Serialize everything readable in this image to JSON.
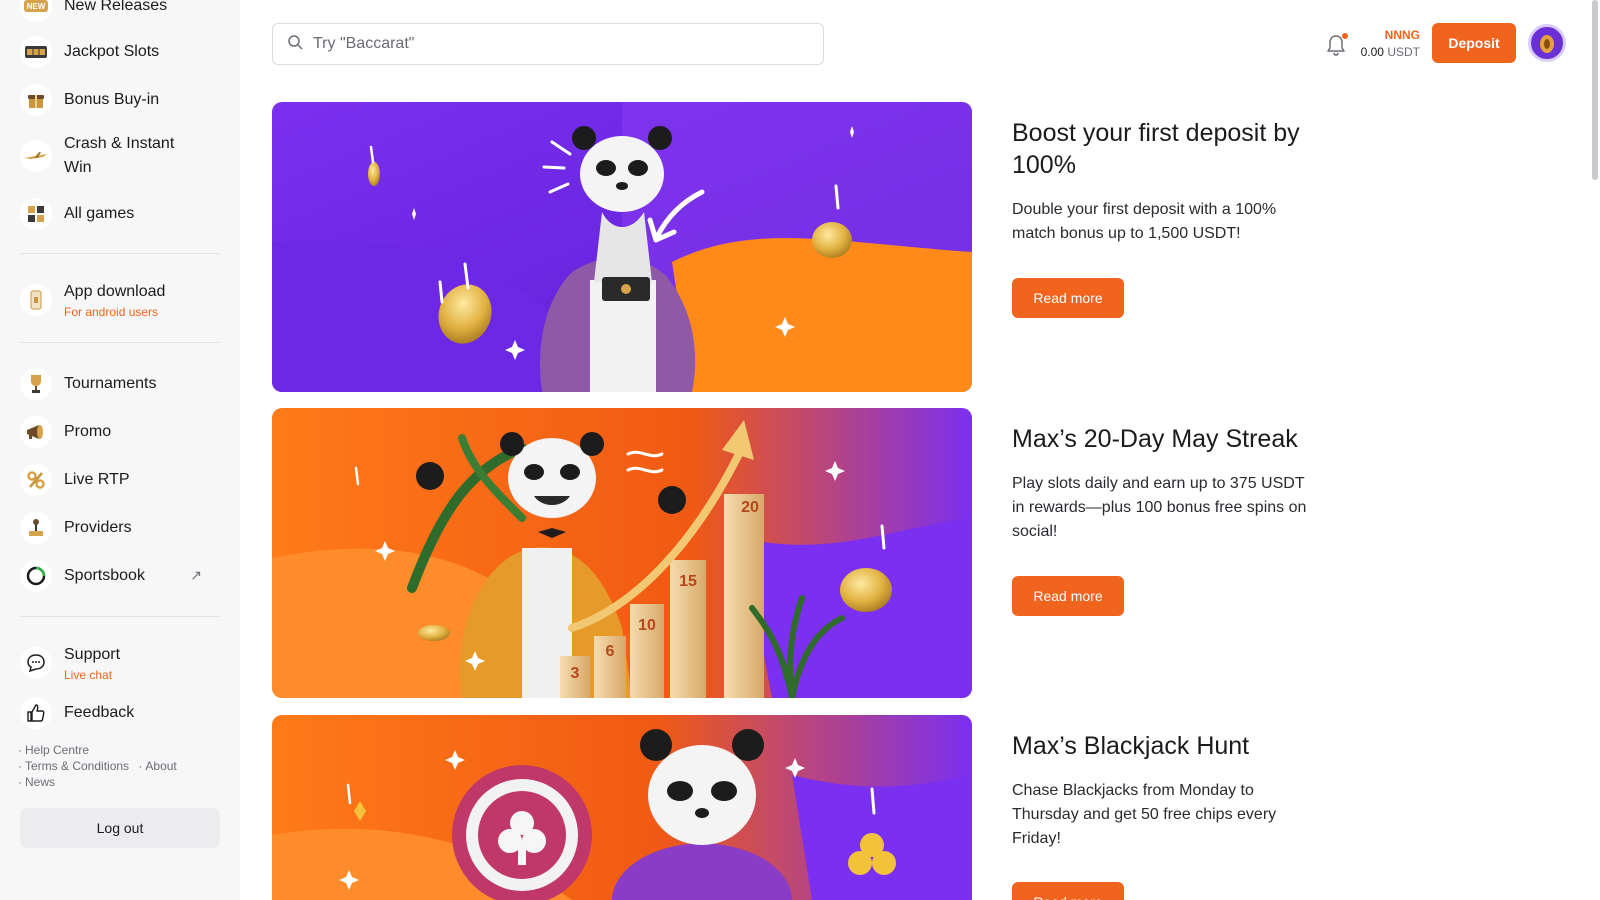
{
  "sidebar": {
    "items": [
      {
        "label": "New Releases",
        "icon": "new-badge-icon"
      },
      {
        "label": "Jackpot Slots",
        "icon": "slot-machine-icon"
      },
      {
        "label": "Bonus Buy-in",
        "icon": "gift-box-icon"
      },
      {
        "label": "Crash & Instant Win",
        "icon": "airplane-icon"
      },
      {
        "label": "All games",
        "icon": "grid-icon"
      },
      {
        "label": "App download",
        "sub": "For android users",
        "icon": "phone-icon"
      },
      {
        "label": "Tournaments",
        "icon": "trophy-icon"
      },
      {
        "label": "Promo",
        "icon": "megaphone-icon"
      },
      {
        "label": "Live RTP",
        "icon": "percent-icon"
      },
      {
        "label": "Providers",
        "icon": "joystick-icon"
      },
      {
        "label": "Sportsbook",
        "icon": "sportsbook-icon"
      },
      {
        "label": "Support",
        "sub": "Live chat",
        "icon": "chat-icon"
      },
      {
        "label": "Feedback",
        "icon": "thumbs-up-icon"
      }
    ],
    "footer_links": [
      "Help Centre",
      "Terms & Conditions",
      "About",
      "News"
    ],
    "logout_label": "Log out"
  },
  "header": {
    "search_placeholder": "Try \"Baccarat\"",
    "currency": "NNNG",
    "balance_amount": "0.00",
    "balance_unit": "USDT",
    "deposit_label": "Deposit"
  },
  "promos": [
    {
      "title": "Boost your first deposit by 100%",
      "description": "Double your first deposit with a 100% match bonus up to 1,500 USDT!",
      "button": "Read more"
    },
    {
      "title": "Max’s 20-Day May Streak",
      "description": "Play slots daily and earn up to 375 USDT in rewards—plus 100 bonus free spins on social!",
      "button": "Read more"
    },
    {
      "title": "Max’s Blackjack Hunt",
      "description": "Chase Blackjacks from Monday to Thursday and get 50 free chips every Friday!",
      "button": "Read more"
    }
  ],
  "banner2_steps": [
    "3",
    "6",
    "10",
    "15",
    "20"
  ],
  "colors": {
    "accent": "#f0641e",
    "purple": "#6a2fd6",
    "sidebar_bg": "#f7f7f8"
  }
}
